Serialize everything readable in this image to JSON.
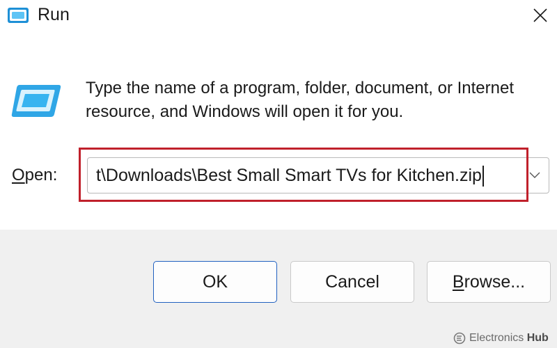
{
  "window": {
    "title": "Run",
    "title_icon": "run-icon",
    "close_icon": "close-icon"
  },
  "content": {
    "app_icon": "run-icon",
    "description": "Type the name of a program, folder, document, or Internet resource, and Windows will open it for you.",
    "open_label_underlined": "O",
    "open_label_rest": "pen:",
    "input_value": "t\\Downloads\\Best Small Smart TVs for Kitchen.zip",
    "dropdown_icon": "chevron-down-icon"
  },
  "buttons": {
    "ok": "OK",
    "cancel": "Cancel",
    "browse_underlined": "B",
    "browse_rest": "rowse..."
  },
  "watermark": {
    "brand_main": "Electronics",
    "brand_bold": "Hub"
  },
  "colors": {
    "highlight": "#c0202b",
    "accent": "#1f5fbf",
    "footer_bg": "#f0f0f0"
  }
}
